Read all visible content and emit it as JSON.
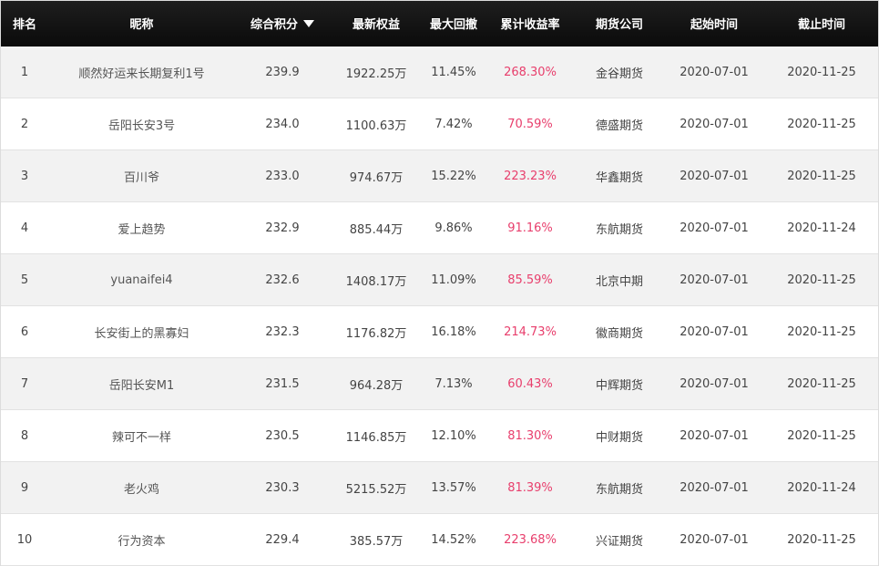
{
  "table": {
    "headers": {
      "rank": "排名",
      "nickname": "昵称",
      "score": "综合积分",
      "equity": "最新权益",
      "drawdown": "最大回撤",
      "return": "累计收益率",
      "company": "期货公司",
      "start": "起始时间",
      "end": "截止时间"
    },
    "sort_icon": "caret-down-icon",
    "accent_color": "#e83e6c",
    "rows": [
      {
        "rank": "1",
        "nickname": "顺然好运来长期复利1号",
        "score": "239.9",
        "equity": "1922.25万",
        "drawdown": "11.45%",
        "return": "268.30%",
        "company": "金谷期货",
        "start": "2020-07-01",
        "end": "2020-11-25"
      },
      {
        "rank": "2",
        "nickname": "岳阳长安3号",
        "score": "234.0",
        "equity": "1100.63万",
        "drawdown": "7.42%",
        "return": "70.59%",
        "company": "德盛期货",
        "start": "2020-07-01",
        "end": "2020-11-25"
      },
      {
        "rank": "3",
        "nickname": "百川爷",
        "score": "233.0",
        "equity": "974.67万",
        "drawdown": "15.22%",
        "return": "223.23%",
        "company": "华鑫期货",
        "start": "2020-07-01",
        "end": "2020-11-25"
      },
      {
        "rank": "4",
        "nickname": "爱上趋势",
        "score": "232.9",
        "equity": "885.44万",
        "drawdown": "9.86%",
        "return": "91.16%",
        "company": "东航期货",
        "start": "2020-07-01",
        "end": "2020-11-24"
      },
      {
        "rank": "5",
        "nickname": "yuanaifei4",
        "score": "232.6",
        "equity": "1408.17万",
        "drawdown": "11.09%",
        "return": "85.59%",
        "company": "北京中期",
        "start": "2020-07-01",
        "end": "2020-11-25"
      },
      {
        "rank": "6",
        "nickname": "长安街上的黑寡妇",
        "score": "232.3",
        "equity": "1176.82万",
        "drawdown": "16.18%",
        "return": "214.73%",
        "company": "徽商期货",
        "start": "2020-07-01",
        "end": "2020-11-25"
      },
      {
        "rank": "7",
        "nickname": "岳阳长安M1",
        "score": "231.5",
        "equity": "964.28万",
        "drawdown": "7.13%",
        "return": "60.43%",
        "company": "中辉期货",
        "start": "2020-07-01",
        "end": "2020-11-25"
      },
      {
        "rank": "8",
        "nickname": "辣可不一样",
        "score": "230.5",
        "equity": "1146.85万",
        "drawdown": "12.10%",
        "return": "81.30%",
        "company": "中财期货",
        "start": "2020-07-01",
        "end": "2020-11-25"
      },
      {
        "rank": "9",
        "nickname": "老火鸡",
        "score": "230.3",
        "equity": "5215.52万",
        "drawdown": "13.57%",
        "return": "81.39%",
        "company": "东航期货",
        "start": "2020-07-01",
        "end": "2020-11-24"
      },
      {
        "rank": "10",
        "nickname": "行为资本",
        "score": "229.4",
        "equity": "385.57万",
        "drawdown": "14.52%",
        "return": "223.68%",
        "company": "兴证期货",
        "start": "2020-07-01",
        "end": "2020-11-25"
      }
    ]
  }
}
